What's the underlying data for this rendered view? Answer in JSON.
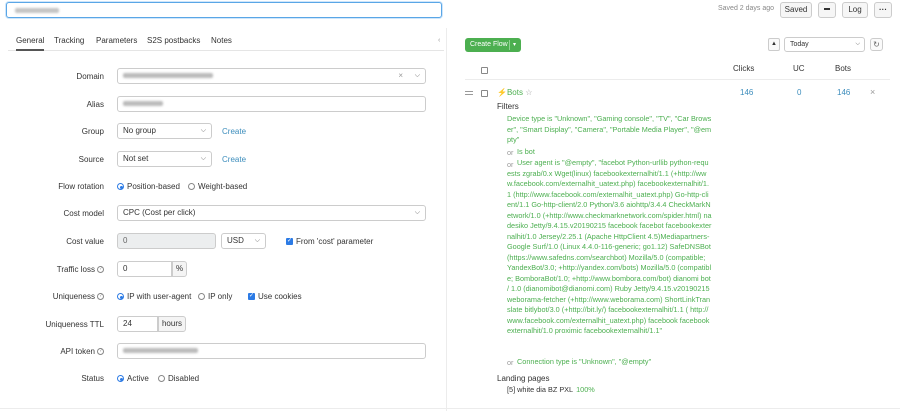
{
  "topbar": {
    "saved_note": "Saved 2 days ago",
    "saved_label": "Saved",
    "log_label": "Log",
    "more_label": "···"
  },
  "tabs": [
    {
      "label": "General",
      "active": true
    },
    {
      "label": "Tracking"
    },
    {
      "label": "Parameters"
    },
    {
      "label": "S2S postbacks"
    },
    {
      "label": "Notes"
    }
  ],
  "form": {
    "domain_label": "Domain",
    "alias_label": "Alias",
    "group_label": "Group",
    "group_value": "No group",
    "group_create": "Create",
    "source_label": "Source",
    "source_value": "Not set",
    "source_create": "Create",
    "rotation_label": "Flow rotation",
    "rotation_opt1": "Position-based",
    "rotation_opt2": "Weight-based",
    "cost_model_label": "Cost model",
    "cost_model_value": "CPC (Cost per click)",
    "cost_value_label": "Cost value",
    "cost_value": "0",
    "currency": "USD",
    "from_cost_param": "From 'cost' parameter",
    "traffic_loss_label": "Traffic loss",
    "traffic_loss_value": "0",
    "traffic_loss_unit": "%",
    "uniqueness_label": "Uniqueness",
    "uniqueness_opt1": "IP with user-agent",
    "uniqueness_opt2": "IP only",
    "use_cookies": "Use cookies",
    "ttl_label": "Uniqueness TTL",
    "ttl_value": "24",
    "ttl_unit": "hours",
    "api_token_label": "API token",
    "status_label": "Status",
    "status_opt1": "Active",
    "status_opt2": "Disabled"
  },
  "flows": {
    "create_label": "Create Flow",
    "period_value": "Today",
    "col_clicks": "Clicks",
    "col_uc": "UC",
    "col_bots": "Bots",
    "row": {
      "name": "⚡Bots",
      "star": "☆",
      "clicks": "146",
      "uc": "0",
      "bots": "146"
    },
    "filters_title": "Filters",
    "filter1": "Device type is \"Unknown\", \"Gaming console\", \"TV\", \"Car Browser\", \"Smart Display\", \"Camera\", \"Portable Media Player\", \"@empty\"",
    "or1": "or",
    "filter2": "Is bot",
    "or2": "or",
    "filter3": "User agent is \"@empty\", \"facebot Python-urllib python-requests zgrab/0.x Wget(linux) facebookexternalhit/1.1 (+http://www.facebook.com/externalhit_uatext.php) facebookexternalhit/1.1 (http://www.facebook.com/externalhit_uatext.php) Go-http-client/1.1 Go-http-client/2.0 Python/3.6 aiohttp/3.4.4 CheckMarkNetwork/1.0 (+http://www.checkmarknetwork.com/spider.html) nadesiko Jetty/9.4.15.v20190215 facebook facebot facebookexternalhit/1.0 Jersey/2.25.1 (Apache HttpClient 4.5)Mediapartners-Google Surf/1.0 (Linux 4.4.0-116-generic; go1.12) SafeDNSBot (https://www.safedns.com/searchbot) Mozilla/5.0 (compatible; YandexBot/3.0; +http://yandex.com/bots) Mozilla/5.0 (compatible; BomboraBot/1.0; +http://www.bombora.com/bot) dianomi bot / 1.0 (dianomibot@dianomi.com) Ruby Jetty/9.4.15.v20190215 weborama-fetcher (+http://www.weborama.com) ShortLinkTranslate bitlybot/3.0 (+http://bit.ly/) facebookexternalhit/1.1 ( http://www.facebook.com/externalhit_uatext.php) facebook facebookexternalhit/1.0 proximic facebookexternalhit/1.1\"",
    "or3": "or",
    "filter4": "Connection type is \"Unknown\", \"@empty\"",
    "landing_title": "Landing pages",
    "landing_item": "[5] white dia BZ PXL",
    "landing_pct": "100%"
  }
}
